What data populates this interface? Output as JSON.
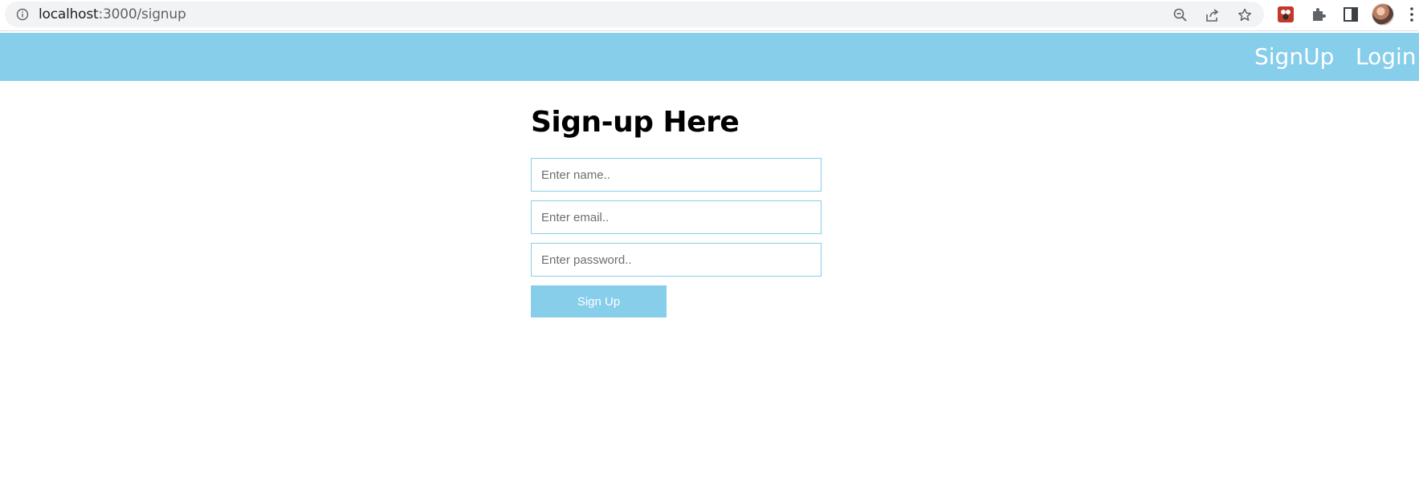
{
  "browser": {
    "url_host": "localhost",
    "url_path": ":3000/signup",
    "icons": [
      "info-icon",
      "zoom-out-icon",
      "share-icon",
      "bookmark-star-icon",
      "extension-app-icon",
      "puzzle-extensions-icon",
      "side-panel-icon",
      "profile-avatar",
      "kebab-menu-icon"
    ]
  },
  "navbar": {
    "bg_color": "#87ceeb",
    "links": [
      {
        "label": "SignUp"
      },
      {
        "label": "Login"
      }
    ]
  },
  "form": {
    "title": "Sign-up Here",
    "name_placeholder": "Enter name..",
    "email_placeholder": "Enter email..",
    "password_placeholder": "Enter password..",
    "submit_label": "Sign Up",
    "accent_color": "#87ceeb"
  }
}
